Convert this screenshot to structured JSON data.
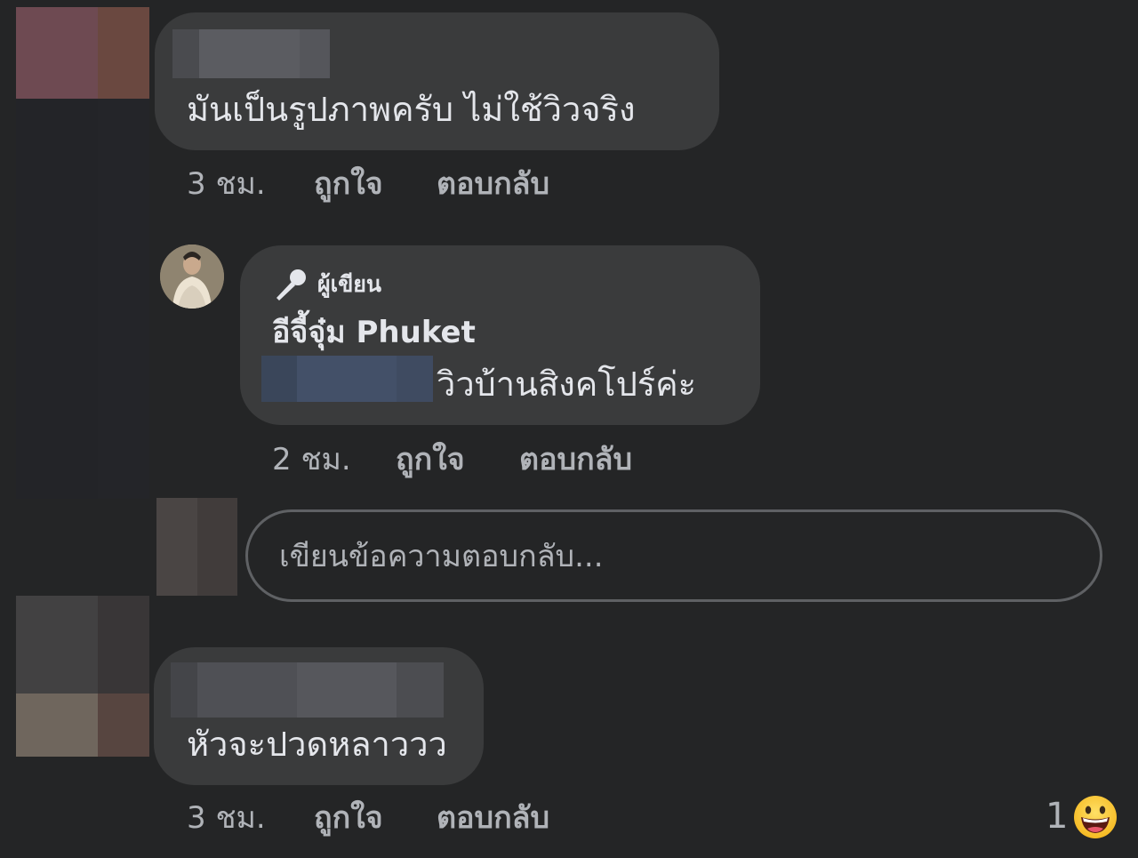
{
  "comments": [
    {
      "text": "มันเป็นรูปภาพครับ ไม่ใช้วิวจริง",
      "time": "3 ชม.",
      "like_label": "ถูกใจ",
      "reply_label": "ตอบกลับ"
    },
    {
      "badge": "ผู้เขียน",
      "badge_icon": "microphone-icon",
      "author": "อีจี้จุ๋ม Phuket",
      "text": "วิวบ้านสิงคโปร์ค่ะ",
      "time": "2 ชม.",
      "like_label": "ถูกใจ",
      "reply_label": "ตอบกลับ"
    },
    {
      "text": "หัวจะปวดหลาววว",
      "time": "3 ชม.",
      "like_label": "ถูกใจ",
      "reply_label": "ตอบกลับ",
      "reaction_count": "1",
      "reaction_icon": "grinning-face-icon"
    }
  ],
  "reply_box": {
    "placeholder": "เขียนข้อความตอบกลับ..."
  },
  "colors": {
    "background": "#242526",
    "bubble": "#3a3b3c",
    "text": "#e4e6eb",
    "meta": "#b0b3b8",
    "input_border": "#5f6164"
  }
}
